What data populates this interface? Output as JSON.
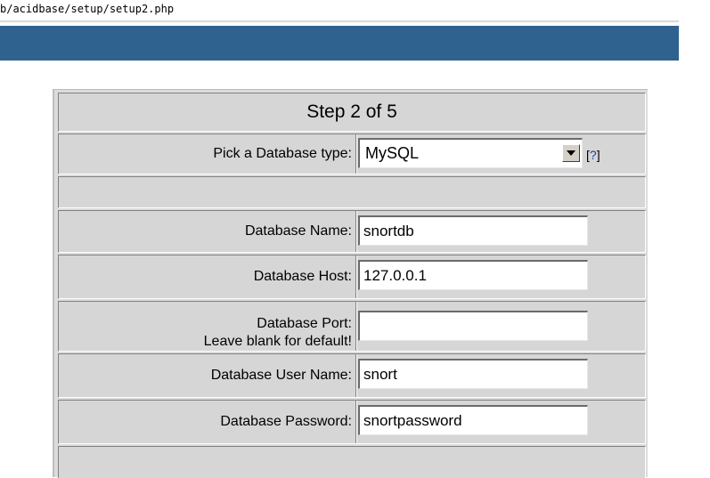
{
  "address_bar": {
    "url": "b/acidbase/setup/setup2.php"
  },
  "form": {
    "step_title": "Step 2 of 5",
    "db_type": {
      "label": "Pick a Database type:",
      "value": "MySQL"
    },
    "help": {
      "open": "[",
      "mark": "?",
      "close": "]"
    },
    "db_name": {
      "label": "Database Name:",
      "value": "snortdb"
    },
    "db_host": {
      "label": "Database Host:",
      "value": "127.0.0.1"
    },
    "db_port": {
      "label_line1": "Database Port:",
      "label_line2": "Leave blank for default!",
      "value": ""
    },
    "db_user": {
      "label": "Database User Name:",
      "value": "snort"
    },
    "db_password": {
      "label": "Database Password:",
      "value": "snortpassword"
    }
  },
  "colors": {
    "header_bar": "#2f628f",
    "panel": "#dcdcdc",
    "help_link": "#1a3c9c"
  }
}
